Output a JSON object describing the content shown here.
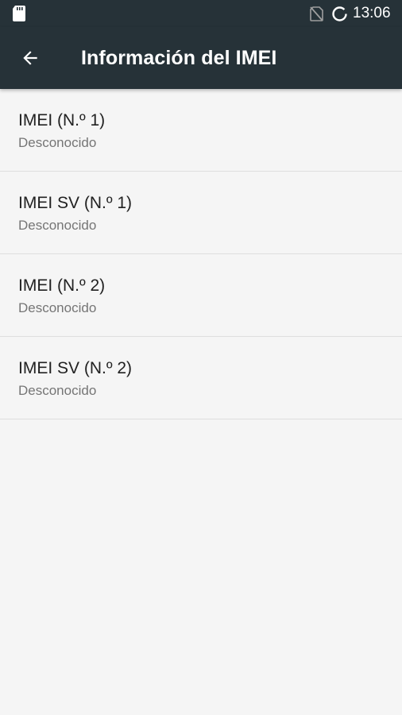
{
  "status_bar": {
    "time": "13:06",
    "icons": [
      "sd-card-icon",
      "no-sim-icon",
      "sync-icon"
    ]
  },
  "toolbar": {
    "back_icon": "arrow-back-icon",
    "title": "Información del IMEI"
  },
  "items": [
    {
      "title": "IMEI (N.º 1)",
      "summary": "Desconocido"
    },
    {
      "title": "IMEI SV (N.º 1)",
      "summary": "Desconocido"
    },
    {
      "title": "IMEI (N.º 2)",
      "summary": "Desconocido"
    },
    {
      "title": "IMEI SV (N.º 2)",
      "summary": "Desconocido"
    }
  ],
  "colors": {
    "app_bar": "#263238",
    "background": "#f5f5f5",
    "primary_text": "#212121",
    "secondary_text": "#757575",
    "divider": "#dedede"
  }
}
